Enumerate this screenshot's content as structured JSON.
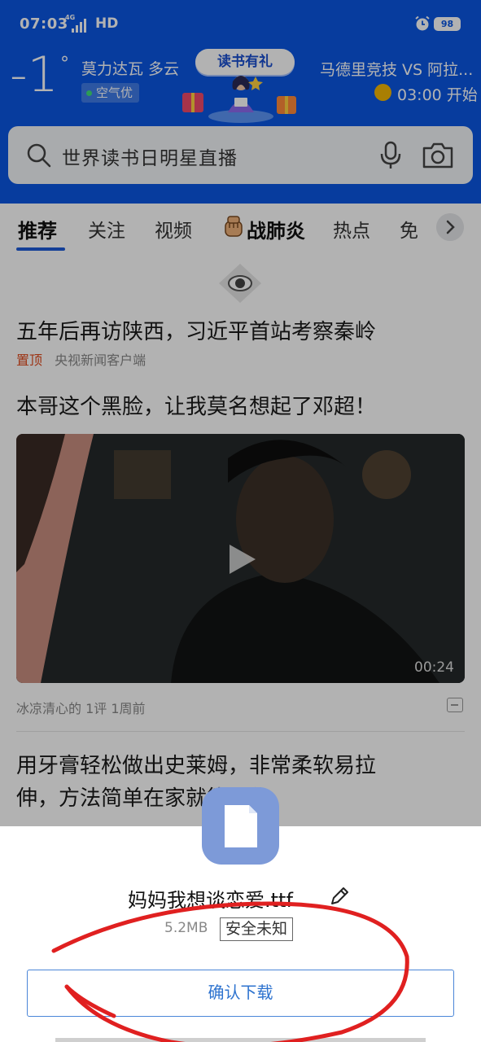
{
  "status_bar": {
    "time": "07:03",
    "network_type": "4G",
    "hd_label": "HD",
    "battery": "98",
    "alarm_icon": "alarm-clock-icon"
  },
  "weather": {
    "temperature": "-1",
    "degree": "°",
    "location_condition": "莫力达瓦 多云",
    "air_quality": "空气优"
  },
  "promo": {
    "label": "读书有礼"
  },
  "match": {
    "title": "马德里竞技 VS 阿拉...",
    "start_time": "03:00 开始"
  },
  "search": {
    "query": "世界读书日明星直播",
    "icons": [
      "search-icon",
      "microphone-icon",
      "camera-icon"
    ]
  },
  "tabs": {
    "items": [
      "推荐",
      "关注",
      "视频",
      "战肺炎",
      "热点",
      "免"
    ],
    "active_index": 0,
    "more_icon": "chevron-right-icon"
  },
  "feed": {
    "article1": {
      "title": "五年后再访陕西，习近平首站考察秦岭",
      "pin_label": "置顶",
      "source": "央视新闻客户端"
    },
    "article2": {
      "title": "本哥这个黑脸，让我莫名想起了邓超！",
      "video_duration": "00:24",
      "meta": "冰凉清心的  1评  1周前"
    },
    "article3": {
      "title_line1": "用牙膏轻松做出史莱姆，非常柔软易拉",
      "title_line2": "伸，方法简单在家就能制作"
    }
  },
  "download_sheet": {
    "file_name": "妈妈我想谈恋爱.ttf",
    "file_size": "5.2MB",
    "safety_label": "安全未知",
    "confirm_label": "确认下载"
  },
  "colors": {
    "header_blue": "#0b57e3",
    "tab_underline": "#1e5bd9",
    "pin_red": "#e0491c",
    "button_blue": "#2e73cf",
    "annotation_red": "#e02020"
  }
}
